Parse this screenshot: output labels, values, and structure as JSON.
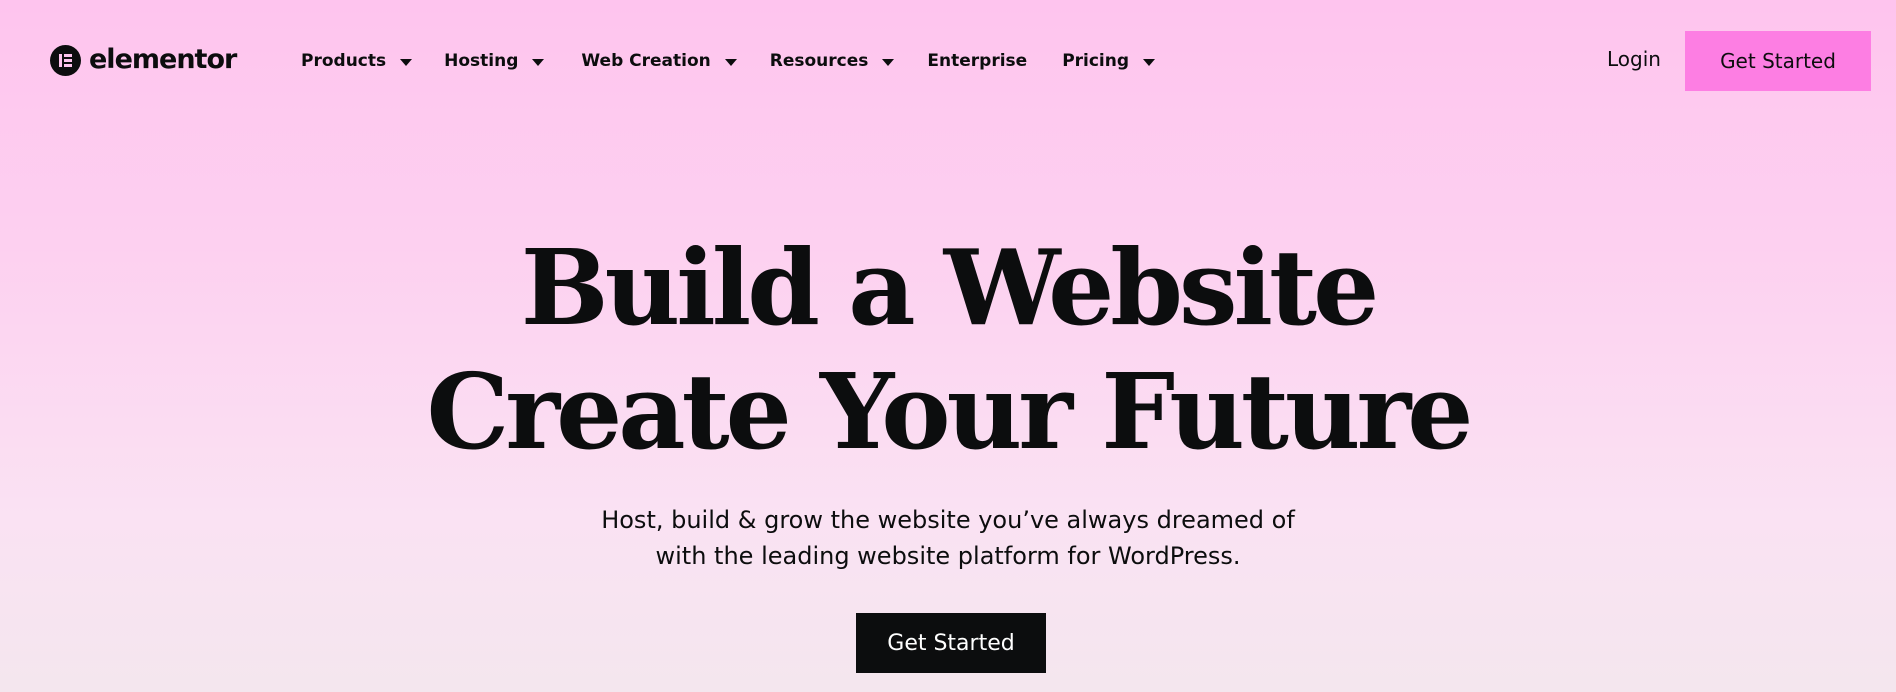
{
  "brand": {
    "name": "elementor",
    "icon": "elementor-logo-icon"
  },
  "nav": {
    "items": [
      {
        "label": "Products",
        "has_dropdown": true
      },
      {
        "label": "Hosting",
        "has_dropdown": true
      },
      {
        "label": "Web Creation",
        "has_dropdown": true
      },
      {
        "label": "Resources",
        "has_dropdown": true
      },
      {
        "label": "Enterprise",
        "has_dropdown": false
      },
      {
        "label": "Pricing",
        "has_dropdown": true
      }
    ],
    "login_label": "Login",
    "cta_label": "Get Started"
  },
  "hero": {
    "title_line1": "Build a Website",
    "title_line2": "Create Your Future",
    "subtitle_line1": "Host, build & grow the website you’ve always dreamed of",
    "subtitle_line2": "with the leading website platform for WordPress.",
    "cta_label": "Get Started"
  },
  "colors": {
    "background_top": "#fec4ee",
    "background_bottom": "#f4e6ee",
    "header_cta": "#fd7ee3",
    "hero_cta": "#0c0d0e",
    "text": "#0c0d0e"
  }
}
